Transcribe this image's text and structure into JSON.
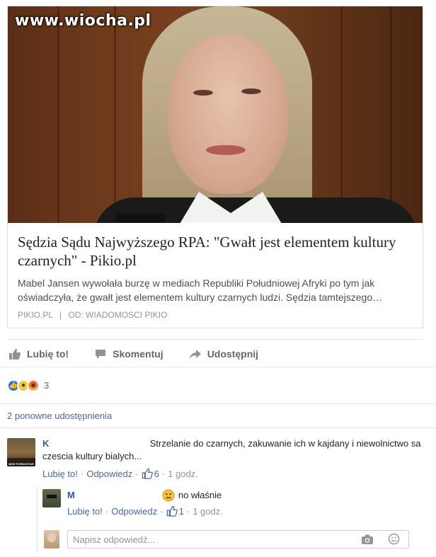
{
  "watermark": "www.wiocha.pl",
  "link_card": {
    "title": "Sędzia Sądu Najwyższego RPA: \"Gwałt jest elementem kultury czarnych\" - Pikio.pl",
    "description": "Mabel Jansen wywołała burzę w mediach Republiki Południowej Afryki po tym jak oświadczyła, że gwałt jest elementem kultury czarnych ludzi. Sędzia tamtejszego…",
    "source_domain": "PIKIO.PL",
    "source_separator": "|",
    "source_via": "OD: WIADOMOSCI PIKIO"
  },
  "actions": {
    "like": "Lubię to!",
    "comment": "Skomentuj",
    "share": "Udostępnij"
  },
  "reactions": {
    "icons": [
      "like-icon",
      "wow-icon",
      "angry-icon"
    ],
    "count": "3"
  },
  "shares": {
    "label": "2 ponowne udostępnienia"
  },
  "comments": [
    {
      "author": "K",
      "text": "Strzelanie do czarnych, zakuwanie ich w kajdany i niewolnictwo sa czescia kultury bialych...",
      "avatar_caption": "NEW PORNOSTAR",
      "like_label": "Lubię to!",
      "reply_label": "Odpowiedz",
      "like_count": "6",
      "time": "1 godz.",
      "replies": [
        {
          "author": "M",
          "emoji": "neutral-face-icon",
          "text": "no właśnie",
          "like_label": "Lubię to!",
          "reply_label": "Odpowiedz",
          "like_count": "1",
          "time": "1 godz."
        }
      ]
    }
  ],
  "reply_input": {
    "placeholder": "Napisz odpowiedź..."
  },
  "colors": {
    "link": "#4b67a1",
    "author": "#365899",
    "like_reaction": "#1d6ff2",
    "muted": "#90949c"
  }
}
